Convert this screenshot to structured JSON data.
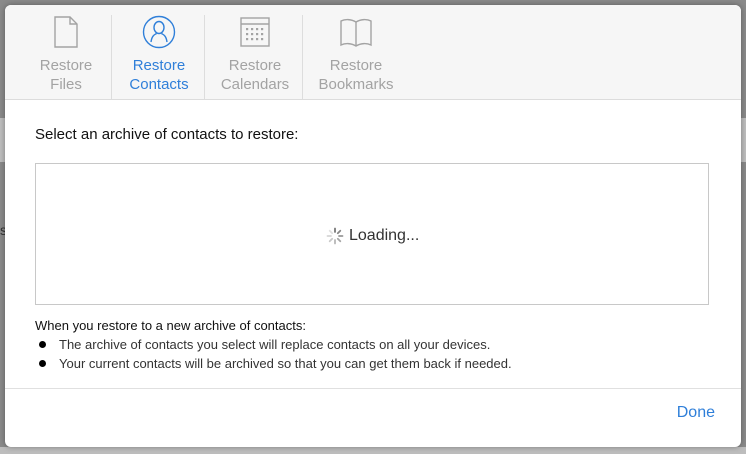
{
  "background": {
    "edge_text": "s"
  },
  "tabs": [
    {
      "line1": "Restore",
      "line2": "Files",
      "icon": "file-icon",
      "active": false
    },
    {
      "line1": "Restore",
      "line2": "Contacts",
      "icon": "contact-icon",
      "active": true
    },
    {
      "line1": "Restore",
      "line2": "Calendars",
      "icon": "calendar-icon",
      "active": false
    },
    {
      "line1": "Restore",
      "line2": "Bookmarks",
      "icon": "book-icon",
      "active": false
    }
  ],
  "content": {
    "prompt": "Select an archive of contacts to restore:",
    "loading_text": "Loading...",
    "info_heading": "When you restore to a new archive of contacts:",
    "bullets": [
      "The archive of contacts you select will replace contacts on all your devices.",
      "Your current contacts will be archived so that you can get them back if needed."
    ]
  },
  "footer": {
    "done_label": "Done"
  },
  "colors": {
    "accent": "#2f7fd9",
    "inactive": "#a3a3a3",
    "toolbar_bg": "#f6f6f6"
  }
}
